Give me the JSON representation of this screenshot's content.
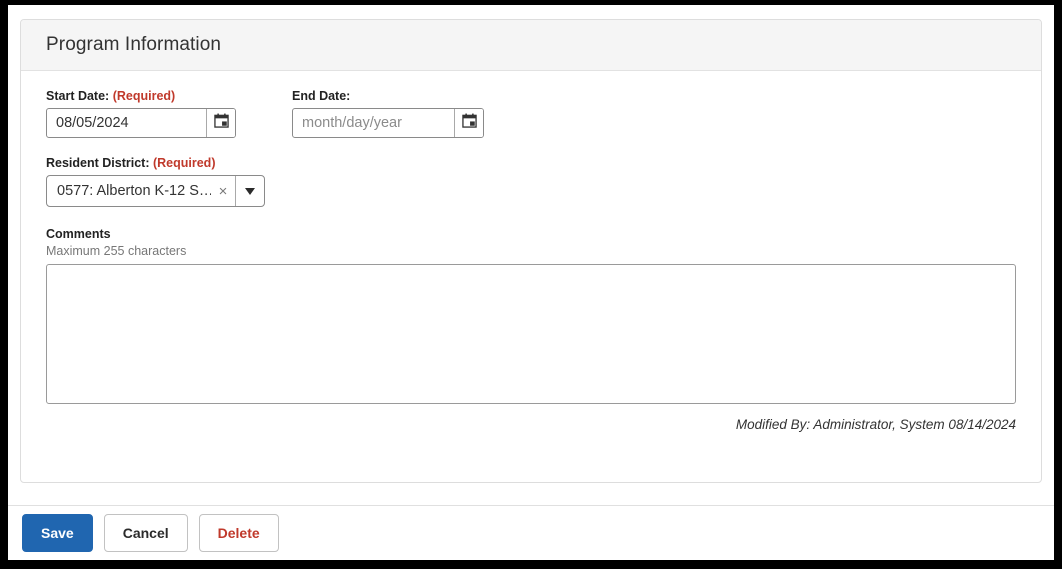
{
  "card": {
    "title": "Program Information"
  },
  "fields": {
    "start_date": {
      "label": "Start Date:",
      "required_text": "(Required)",
      "value": "08/05/2024",
      "calendar_icon": "calendar-icon"
    },
    "end_date": {
      "label": "End Date:",
      "value": "",
      "placeholder": "month/day/year",
      "calendar_icon": "calendar-icon"
    },
    "resident_district": {
      "label": "Resident District:",
      "required_text": "(Required)",
      "value": "0577: Alberton K-12 S…",
      "clear_icon": "×",
      "caret_icon": "chevron-down-icon"
    },
    "comments": {
      "label": "Comments",
      "hint": "Maximum 255 characters",
      "value": "",
      "placeholder": ""
    }
  },
  "modified_by": "Modified By: Administrator, System 08/14/2024",
  "footer": {
    "save_label": "Save",
    "cancel_label": "Cancel",
    "delete_label": "Delete"
  },
  "colors": {
    "accent_blue": "#2066b0",
    "required_red": "#c0392b",
    "header_gray": "#f5f5f5",
    "border_gray": "#dddddd"
  }
}
